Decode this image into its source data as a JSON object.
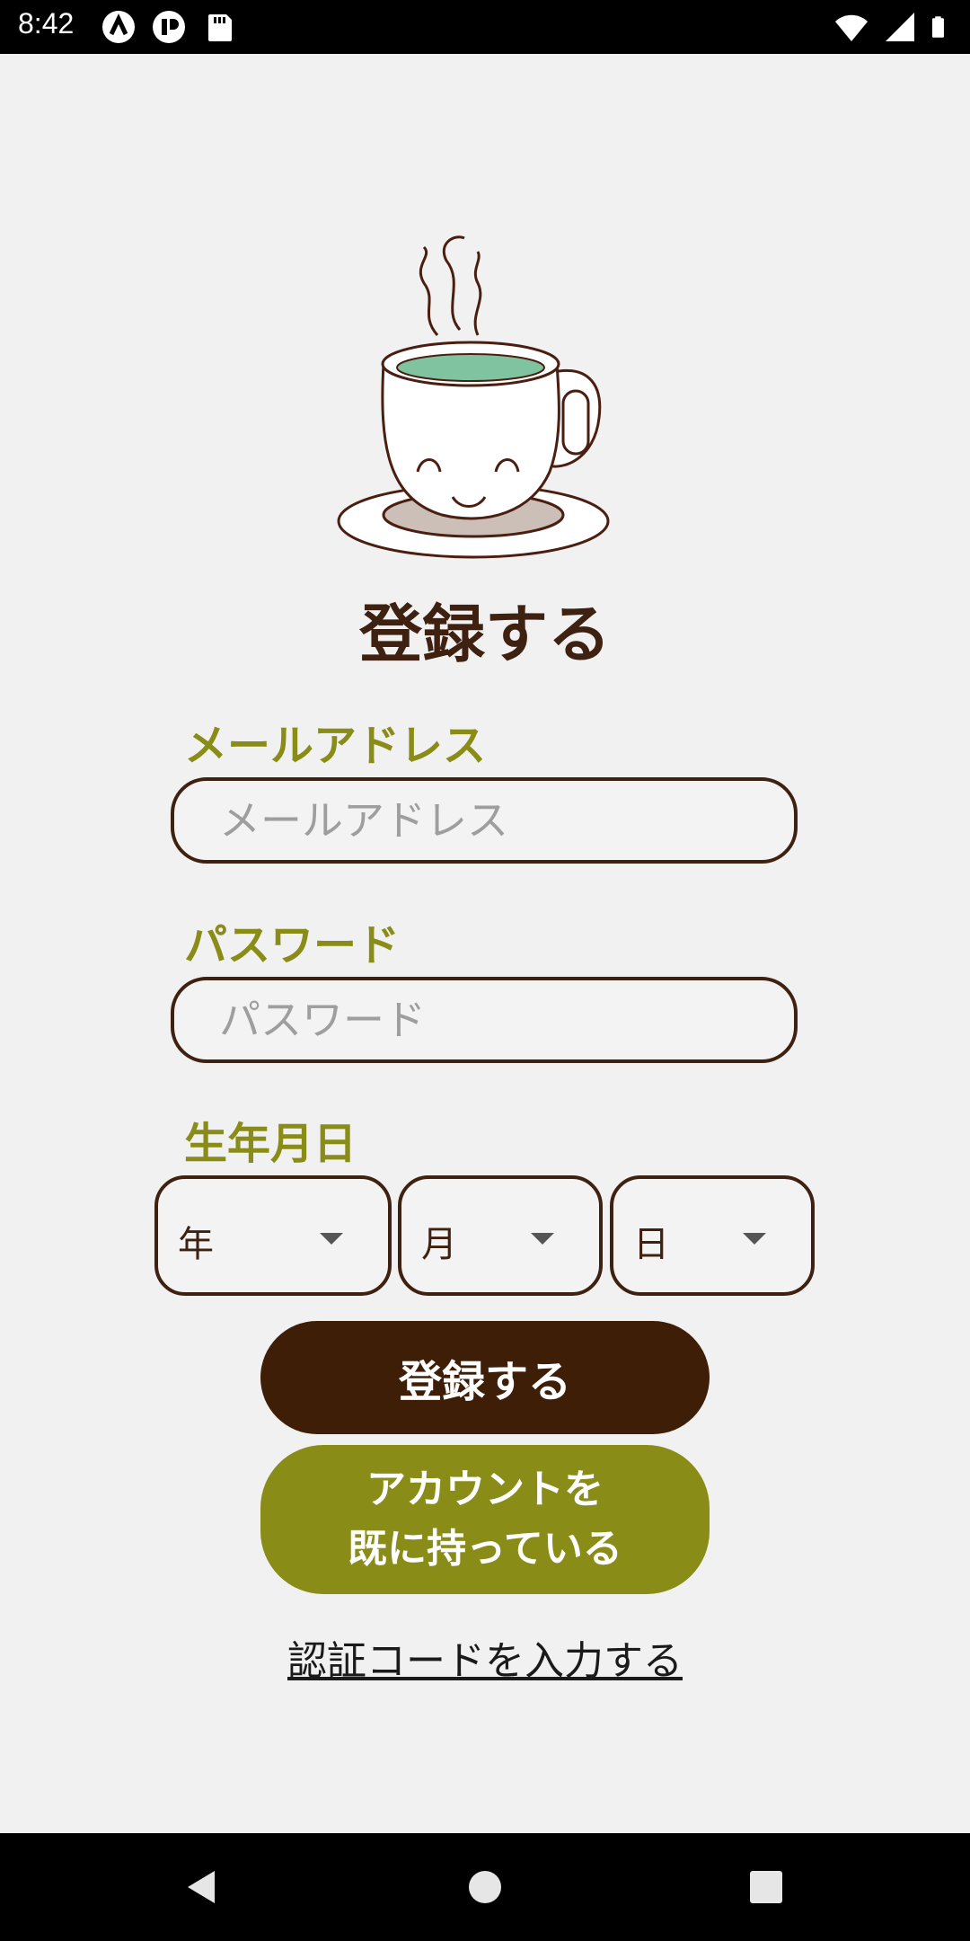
{
  "status_bar": {
    "time": "8:42",
    "left_icons": [
      "app-icon-a",
      "app-icon-b",
      "sd-card-icon"
    ],
    "right_icons": [
      "wifi-icon",
      "cell-signal-icon",
      "battery-icon"
    ]
  },
  "mascot": {
    "icon": "coffee-cup-mascot"
  },
  "title": "登録する",
  "email": {
    "label": "メールアドレス",
    "placeholder": "メールアドレス",
    "value": ""
  },
  "password": {
    "label": "パスワード",
    "placeholder": "パスワード",
    "value": ""
  },
  "birthdate": {
    "label": "生年月日",
    "year": "年",
    "month": "月",
    "day": "日"
  },
  "buttons": {
    "register": "登録する",
    "have_account_line1": "アカウントを",
    "have_account_line2": "既に持っている"
  },
  "verify_link": "認証コードを入力する",
  "nav_bar": {
    "icons": [
      "back-icon",
      "home-icon",
      "recents-icon"
    ]
  },
  "colors": {
    "primary_brown": "#3e1e06",
    "accent_olive": "#8a8c18",
    "background": "#f2f1f1"
  }
}
